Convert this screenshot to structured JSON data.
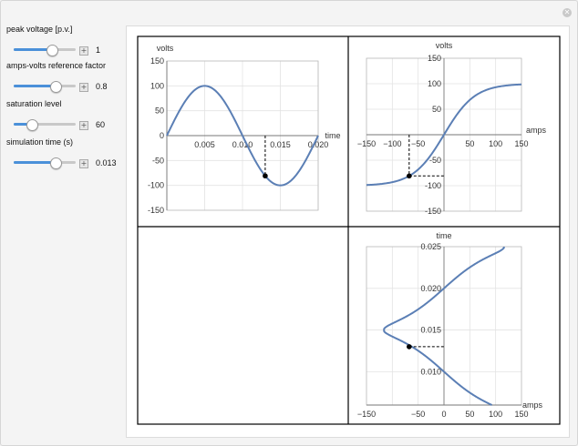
{
  "controls": [
    {
      "label": "peak voltage [p.v.]",
      "value": "1",
      "fraction": 0.62
    },
    {
      "label": "amps-volts reference factor",
      "value": "0.8",
      "fraction": 0.68
    },
    {
      "label": "saturation level",
      "value": "60",
      "fraction": 0.3
    },
    {
      "label": "simulation time (s)",
      "value": "0.013",
      "fraction": 0.68
    }
  ],
  "colors": {
    "curve": "#5b7fb5",
    "marker": "#000000",
    "slider_fill": "#4a90d9"
  },
  "icons": {
    "close": "close-icon",
    "plus": "plus-icon"
  },
  "chart_data": [
    {
      "type": "line",
      "name": "voltage vs time",
      "xlabel": "time",
      "ylabel": "volts",
      "xlim": [
        0,
        0.02
      ],
      "ylim": [
        -150,
        150
      ],
      "xticks": [
        "0.005",
        "0.010",
        "0.015",
        "0.020"
      ],
      "yticks": [
        "150",
        "100",
        "50",
        "0",
        "-50",
        "-100",
        "-150"
      ],
      "function": "v = 100*sin(2*pi*50*t)",
      "point": {
        "x": 0.013,
        "y": -80.9
      }
    },
    {
      "type": "line",
      "name": "magnetization curve",
      "xlabel": "amps",
      "ylabel": "volts",
      "xlim": [
        -150,
        150
      ],
      "ylim": [
        -150,
        150
      ],
      "xticks": [
        "-150",
        "-100",
        "-50",
        "0",
        "50",
        "100",
        "150"
      ],
      "yticks": [
        "150",
        "100",
        "50",
        "-50",
        "-100",
        "-150"
      ],
      "function": "v = 100*tanh(i/60)",
      "point": {
        "x": -67.4,
        "y": -80.9
      }
    },
    {
      "type": "line",
      "name": "current vs time",
      "xlabel": "amps",
      "ylabel": "time",
      "xlim": [
        -150,
        150
      ],
      "ylim": [
        0.006,
        0.025
      ],
      "xticks": [
        "-150",
        "-50",
        "0",
        "50",
        "100",
        "150"
      ],
      "yticks": [
        "0.025",
        "0.020",
        "0.015",
        "0.010"
      ],
      "point": {
        "x": -67.4,
        "y": 0.013
      }
    }
  ]
}
